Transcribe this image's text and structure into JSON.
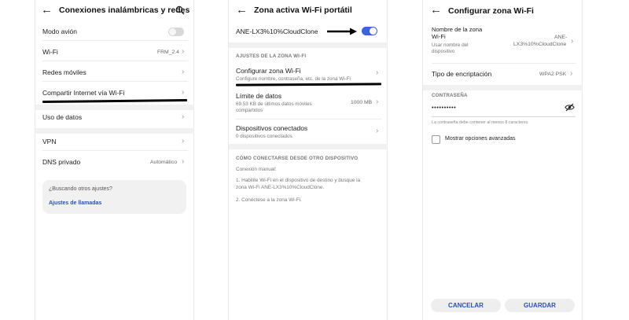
{
  "panel1": {
    "title": "Conexiones inalámbricas y redes",
    "items": [
      {
        "label": "Modo avión"
      },
      {
        "label": "Wi-Fi",
        "value": "FRM_2.4"
      },
      {
        "label": "Redes móviles"
      },
      {
        "label": "Compartir Internet vía Wi-Fi"
      },
      {
        "label": "Uso de datos"
      },
      {
        "label": "VPN"
      },
      {
        "label": "DNS privado",
        "value": "Automático"
      }
    ],
    "card": {
      "question": "¿Buscando otros ajustes?",
      "link": "Ajustes de llamadas"
    }
  },
  "panel2": {
    "title": "Zona activa Wi-Fi portátil",
    "hotspot_name": "ANE-LX3%10%CloudClone",
    "section1": "AJUSTES DE LA ZONA WI-FI",
    "configure": {
      "label": "Configurar zona Wi-Fi",
      "sub": "Configure nombre, contraseña, etc. de la zona Wi-Fi"
    },
    "limit": {
      "label": "Límite de datos",
      "sub1": "69.53 KB de últimos datos móviles",
      "sub2": "compartidos",
      "value": "1000 MB"
    },
    "devices": {
      "label": "Dispositivos conectados",
      "sub": "0 dispositivos conectados"
    },
    "section2": "CÓMO CONECTARSE DESDE OTRO DISPOSITIVO",
    "manual": "Conexión manual:",
    "step1a": "1. Habilite Wi-Fi en el dispositivo de destino y busque la",
    "step1b": "zona Wi-Fi ANE-LX3%10%CloudClone.",
    "step2": "2. Conéctese a la zona Wi-Fi."
  },
  "panel3": {
    "title": "Configurar zona Wi-Fi",
    "name_label1": "Nombre de la zona",
    "name_label2": "Wi-Fi",
    "name_hint1": "Usar nombre del",
    "name_hint2": "dispositivo",
    "name_value1": "ANE-",
    "name_value2": "LX3%10%CloudClone",
    "encryption_label": "Tipo de encriptación",
    "encryption_value": "WPA2 PSK",
    "password_section": "CONTRASEÑA",
    "password_value": "••••••••••",
    "password_hint": "La contraseña debe contener al menos 8 caracteres",
    "advanced_label": "Mostrar opciones avanzadas",
    "cancel": "CANCELAR",
    "save": "GUARDAR"
  },
  "colors": {
    "accent": "#3e63d8",
    "button_text": "#2b4fb5"
  }
}
